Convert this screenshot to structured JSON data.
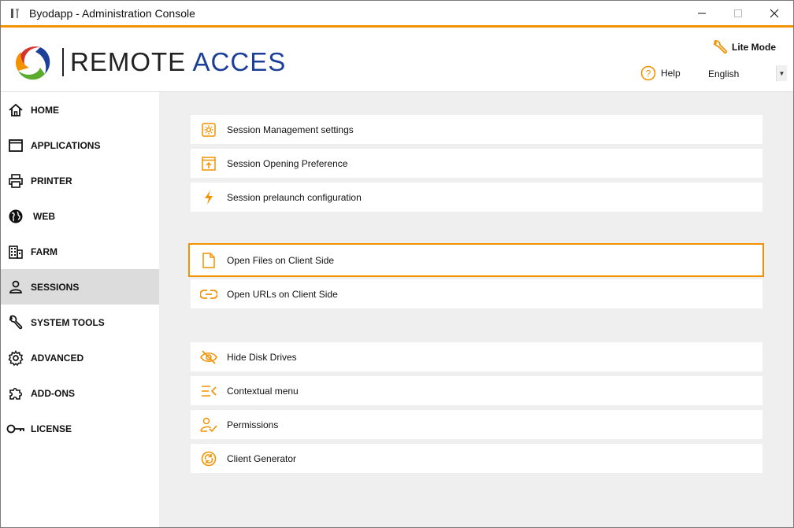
{
  "window": {
    "title": "Byodapp - Administration Console",
    "accent_color": "#f39200",
    "controls": [
      "minimize-icon",
      "maximize-icon",
      "close-icon"
    ]
  },
  "header": {
    "logo_word1": "REMOTE",
    "logo_word2": "ACCES",
    "lite_mode_label": "Lite Mode",
    "help_label": "Help",
    "language": "English"
  },
  "sidebar": {
    "items": [
      {
        "label": "HOME",
        "icon": "home-icon"
      },
      {
        "label": "APPLICATIONS",
        "icon": "window-icon"
      },
      {
        "label": "PRINTER",
        "icon": "printer-icon"
      },
      {
        "label": "WEB",
        "icon": "globe-icon"
      },
      {
        "label": "FARM",
        "icon": "building-icon"
      },
      {
        "label": "SESSIONS",
        "icon": "user-icon",
        "active": true
      },
      {
        "label": "SYSTEM TOOLS",
        "icon": "wrench-icon"
      },
      {
        "label": "ADVANCED",
        "icon": "gear-icon"
      },
      {
        "label": "ADD-ONS",
        "icon": "puzzle-icon"
      },
      {
        "label": "LICENSE",
        "icon": "key-icon"
      }
    ]
  },
  "main": {
    "items": [
      {
        "label": "Session Management settings",
        "icon": "settings-icon"
      },
      {
        "label": "Session Opening Preference",
        "icon": "upload-window-icon"
      },
      {
        "label": "Session prelaunch configuration",
        "icon": "lightning-icon"
      },
      {
        "label": "Open Files on Client Side",
        "icon": "file-icon",
        "selected": true
      },
      {
        "label": "Open URLs on Client Side",
        "icon": "link-icon"
      },
      {
        "label": "Hide Disk Drives",
        "icon": "eye-off-icon"
      },
      {
        "label": "Contextual menu",
        "icon": "menu-icon"
      },
      {
        "label": "Permissions",
        "icon": "user-check-icon"
      },
      {
        "label": "Client Generator",
        "icon": "refresh-icon"
      }
    ]
  }
}
